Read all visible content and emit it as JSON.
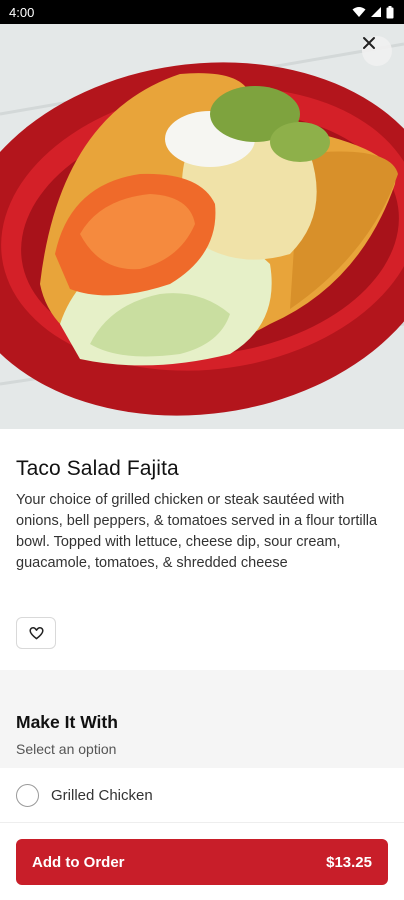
{
  "status_bar": {
    "time": "4:00",
    "icons": [
      "wifi-icon",
      "signal-icon",
      "battery-icon"
    ]
  },
  "hero": {
    "icon": "close-icon"
  },
  "item": {
    "title": "Taco Salad Fajita",
    "description": "Your choice of grilled chicken or steak sautéed with onions, bell peppers, & tomatoes served in a flour tortilla bowl. Topped with lettuce, cheese dip, sour cream, guacamole, tomatoes, & shredded cheese",
    "favorite_icon": "heart-icon"
  },
  "section": {
    "title": "Make It With",
    "subtitle": "Select an option",
    "options": [
      {
        "label": "Grilled Chicken",
        "selected": false
      }
    ]
  },
  "footer": {
    "add_label": "Add to Order",
    "price": "$13.25"
  },
  "colors": {
    "accent": "#c81e29"
  }
}
